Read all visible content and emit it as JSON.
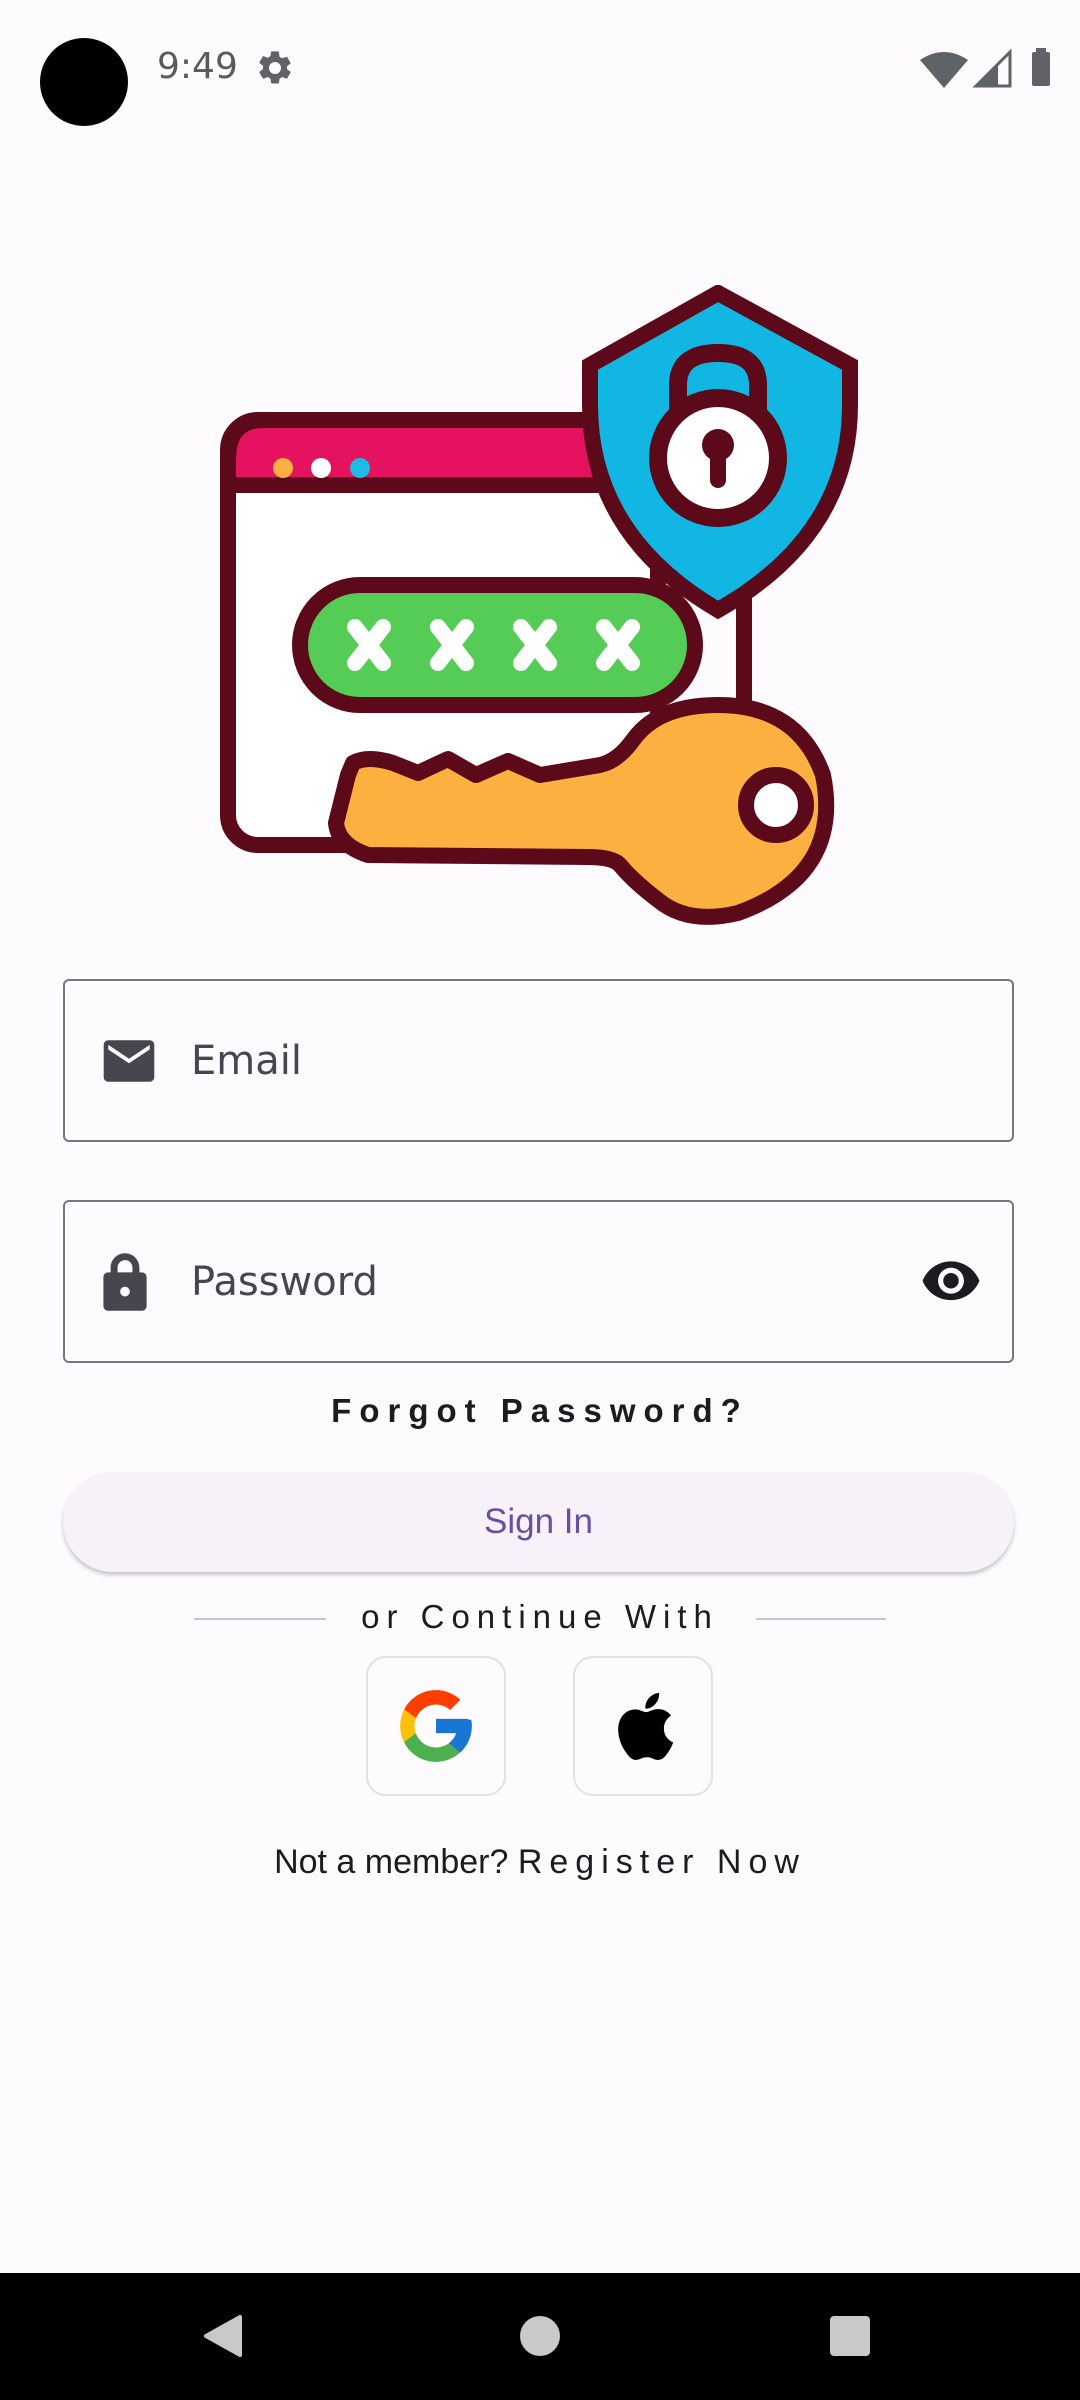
{
  "status_bar": {
    "time": "9:49"
  },
  "login": {
    "email_placeholder": "Email",
    "password_placeholder": "Password",
    "forgot_label": "Forgot Password?",
    "sign_in_label": "Sign In",
    "divider_text": "or Continue With",
    "register_prefix": "Not a member? ",
    "register_link": "Register Now"
  },
  "icons": {
    "email": "mail-icon",
    "password": "lock-icon",
    "visibility": "eye-icon",
    "google": "google-icon",
    "apple": "apple-icon"
  },
  "colors": {
    "accent": "#6750a4",
    "background": "#fefbff",
    "field_border": "#7a757f"
  }
}
